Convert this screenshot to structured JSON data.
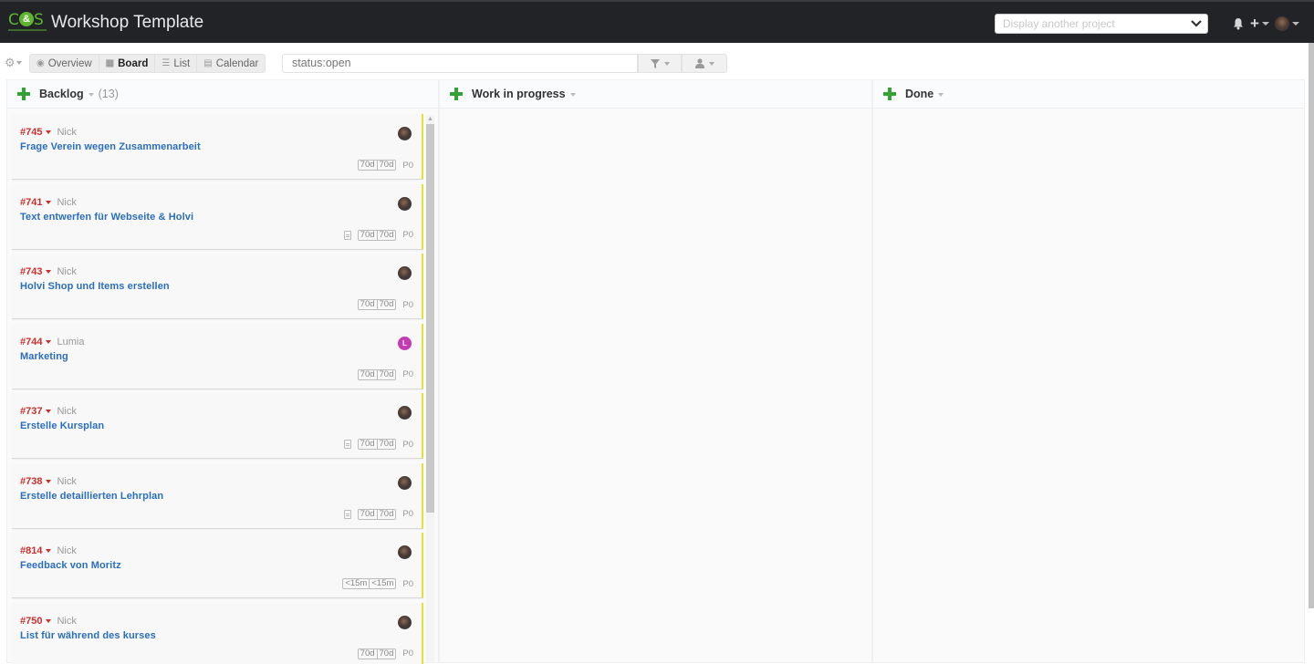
{
  "header": {
    "logo": {
      "left": "C",
      "mid": "&",
      "right": "S"
    },
    "title": "Workshop Template",
    "project_select_placeholder": "Display another project"
  },
  "toolbar": {
    "views": [
      {
        "label": "Overview",
        "icon": "eye-icon",
        "active": false
      },
      {
        "label": "Board",
        "icon": "th-icon",
        "active": true
      },
      {
        "label": "List",
        "icon": "list-icon",
        "active": false
      },
      {
        "label": "Calendar",
        "icon": "calendar-icon",
        "active": false
      }
    ],
    "search_value": "status:open"
  },
  "columns": [
    {
      "title": "Backlog",
      "count": "(13)"
    },
    {
      "title": "Work in progress",
      "count": ""
    },
    {
      "title": "Done",
      "count": ""
    }
  ],
  "cards": [
    {
      "id": "#745",
      "assignee": "Nick",
      "title": "Frage Verein wegen Zusammenarbeit",
      "avatar": "photo",
      "has_doc": false,
      "estimate": [
        "70d",
        "70d"
      ],
      "priority": "P0"
    },
    {
      "id": "#741",
      "assignee": "Nick",
      "title": "Text entwerfen für Webseite & Holvi",
      "avatar": "photo",
      "has_doc": true,
      "estimate": [
        "70d",
        "70d"
      ],
      "priority": "P0"
    },
    {
      "id": "#743",
      "assignee": "Nick",
      "title": "Holvi Shop und Items erstellen",
      "avatar": "photo",
      "has_doc": false,
      "estimate": [
        "70d",
        "70d"
      ],
      "priority": "P0"
    },
    {
      "id": "#744",
      "assignee": "Lumia",
      "title": "Marketing",
      "avatar": "L",
      "has_doc": false,
      "estimate": [
        "70d",
        "70d"
      ],
      "priority": "P0"
    },
    {
      "id": "#737",
      "assignee": "Nick",
      "title": "Erstelle Kursplan",
      "avatar": "photo",
      "has_doc": true,
      "estimate": [
        "70d",
        "70d"
      ],
      "priority": "P0"
    },
    {
      "id": "#738",
      "assignee": "Nick",
      "title": "Erstelle detaillierten Lehrplan",
      "avatar": "photo",
      "has_doc": true,
      "estimate": [
        "70d",
        "70d"
      ],
      "priority": "P0"
    },
    {
      "id": "#814",
      "assignee": "Nick",
      "title": "Feedback von Moritz",
      "avatar": "photo",
      "has_doc": false,
      "estimate": [
        "<15m",
        "<15m"
      ],
      "priority": "P0"
    },
    {
      "id": "#750",
      "assignee": "Nick",
      "title": "List für während des kurses",
      "avatar": "photo",
      "has_doc": false,
      "estimate": [
        "70d",
        "70d"
      ],
      "priority": "P0"
    }
  ],
  "colors": {
    "navbar": "#222326",
    "brand_green": "#5db530",
    "add_green": "#34a234",
    "issue_id_red": "#c9302c",
    "title_blue": "#2a6ebd",
    "card_accent_yellow": "#dfe433",
    "lumia_avatar": "#c23bb5"
  }
}
